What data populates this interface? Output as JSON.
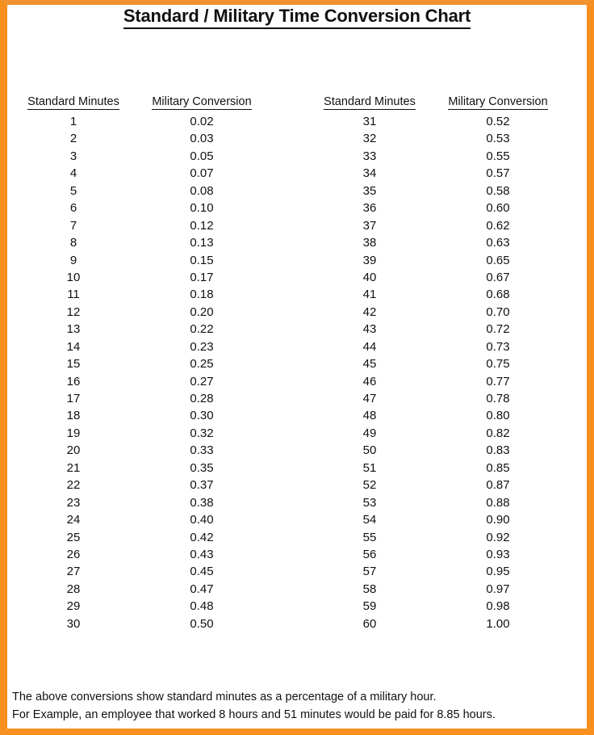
{
  "document": {
    "title": "Standard / Military Time Conversion Chart",
    "accent_color": "#F7901E",
    "text_color": "#111111",
    "background_color": "#FFFFFF"
  },
  "headers": {
    "standard_minutes": "Standard Minutes",
    "military_conversion": "Military Conversion"
  },
  "chart_data": {
    "type": "table",
    "title": "Standard / Military Time Conversion Chart",
    "columns": [
      "Standard Minutes",
      "Military Conversion"
    ],
    "layout": "two side-by-side blocks: minutes 1-30 on the left, 31-60 on the right",
    "left_block": {
      "minutes": [
        1,
        2,
        3,
        4,
        5,
        6,
        7,
        8,
        9,
        10,
        11,
        12,
        13,
        14,
        15,
        16,
        17,
        18,
        19,
        20,
        21,
        22,
        23,
        24,
        25,
        26,
        27,
        28,
        29,
        30
      ],
      "conversions": [
        "0.02",
        "0.03",
        "0.05",
        "0.07",
        "0.08",
        "0.10",
        "0.12",
        "0.13",
        "0.15",
        "0.17",
        "0.18",
        "0.20",
        "0.22",
        "0.23",
        "0.25",
        "0.27",
        "0.28",
        "0.30",
        "0.32",
        "0.33",
        "0.35",
        "0.37",
        "0.38",
        "0.40",
        "0.42",
        "0.43",
        "0.45",
        "0.47",
        "0.48",
        "0.50"
      ]
    },
    "right_block": {
      "minutes": [
        31,
        32,
        33,
        34,
        35,
        36,
        37,
        38,
        39,
        40,
        41,
        42,
        43,
        44,
        45,
        46,
        47,
        48,
        49,
        50,
        51,
        52,
        53,
        54,
        55,
        56,
        57,
        58,
        59,
        60
      ],
      "conversions": [
        "0.52",
        "0.53",
        "0.55",
        "0.57",
        "0.58",
        "0.60",
        "0.62",
        "0.63",
        "0.65",
        "0.67",
        "0.68",
        "0.70",
        "0.72",
        "0.73",
        "0.75",
        "0.77",
        "0.78",
        "0.80",
        "0.82",
        "0.83",
        "0.85",
        "0.87",
        "0.88",
        "0.90",
        "0.92",
        "0.93",
        "0.95",
        "0.97",
        "0.98",
        "1.00"
      ]
    }
  },
  "footer": {
    "line1": "The above conversions show standard minutes as a percentage of a military hour.",
    "line2": "For Example, an employee that worked 8 hours and 51 minutes would be paid for 8.85 hours."
  }
}
